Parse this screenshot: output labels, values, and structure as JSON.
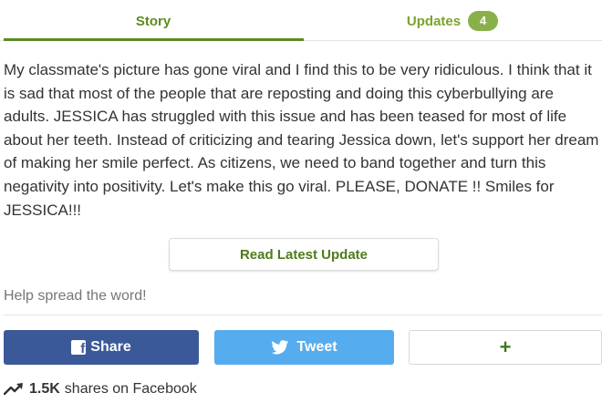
{
  "tabs": {
    "story_label": "Story",
    "updates_label": "Updates",
    "updates_count": "4"
  },
  "story": {
    "text": "My classmate's picture has gone viral and I find this to be very ridiculous. I think that it is sad that most of the people that are reposting and doing this cyberbullying are adults. JESSICA has struggled with this issue and has been teased for most of life about her teeth. Instead of criticizing and tearing Jessica down, let's support her dream of making her smile perfect. As citizens, we need to band together and turn this negativity into positivity. Let's make this go viral. PLEASE, DONATE !! Smiles for JESSICA!!!"
  },
  "update_button": {
    "label": "Read Latest Update"
  },
  "spread": {
    "label": "Help spread the word!"
  },
  "share_buttons": {
    "facebook_label": "Share",
    "twitter_label": "Tweet",
    "more_label": "+"
  },
  "share_stats": {
    "count": "1.5K",
    "label": "shares on Facebook"
  },
  "colors": {
    "accent": "#5f8b1f",
    "badge": "#8ab04a",
    "facebook": "#3b5998",
    "twitter": "#55acee"
  },
  "icons": {
    "facebook": "facebook-icon",
    "twitter": "twitter-icon",
    "trend": "trending-up-icon"
  }
}
